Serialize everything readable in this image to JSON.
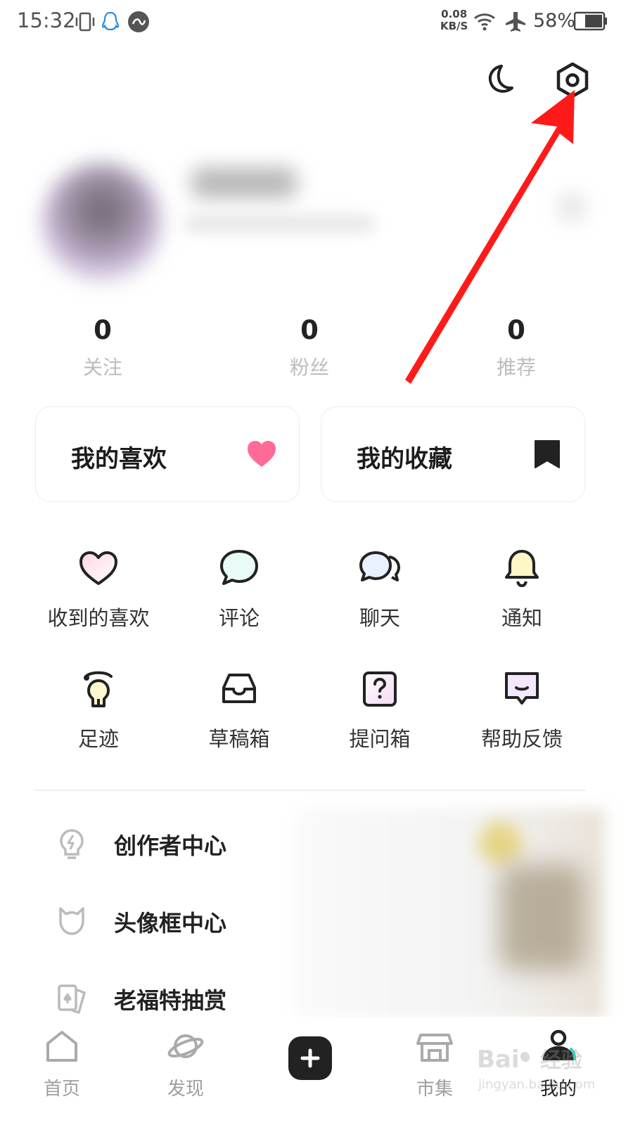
{
  "status_bar": {
    "time": "15:32",
    "net_speed_value": "0.08",
    "net_speed_unit": "KB/S",
    "battery_pct": "58%"
  },
  "header": {
    "icons": [
      "moon-icon",
      "settings-icon"
    ]
  },
  "stats": [
    {
      "value": "0",
      "label": "关注"
    },
    {
      "value": "0",
      "label": "粉丝"
    },
    {
      "value": "0",
      "label": "推荐"
    }
  ],
  "cards": {
    "likes_label": "我的喜欢",
    "favorites_label": "我的收藏"
  },
  "grid": [
    {
      "label": "收到的喜欢",
      "icon": "heart-outline-icon"
    },
    {
      "label": "评论",
      "icon": "comment-icon"
    },
    {
      "label": "聊天",
      "icon": "chat-icon"
    },
    {
      "label": "通知",
      "icon": "bell-icon"
    },
    {
      "label": "足迹",
      "icon": "bulb-icon"
    },
    {
      "label": "草稿箱",
      "icon": "inbox-icon"
    },
    {
      "label": "提问箱",
      "icon": "question-box-icon"
    },
    {
      "label": "帮助反馈",
      "icon": "feedback-icon"
    }
  ],
  "list": [
    {
      "label": "创作者中心",
      "icon": "lightning-bulb-icon"
    },
    {
      "label": "头像框中心",
      "icon": "avatar-frame-icon"
    },
    {
      "label": "老福特抽赏",
      "icon": "cards-icon"
    }
  ],
  "nav": [
    {
      "label": "首页",
      "icon": "home-icon"
    },
    {
      "label": "发现",
      "icon": "planet-icon"
    },
    {
      "label": "市集",
      "icon": "shop-icon"
    },
    {
      "label": "我的",
      "icon": "profile-icon"
    }
  ],
  "colors": {
    "accent_pink": "#ff6b96",
    "arrow_red": "#ff1a1a",
    "text_dark": "#222222",
    "text_muted": "#bdbdbd"
  }
}
